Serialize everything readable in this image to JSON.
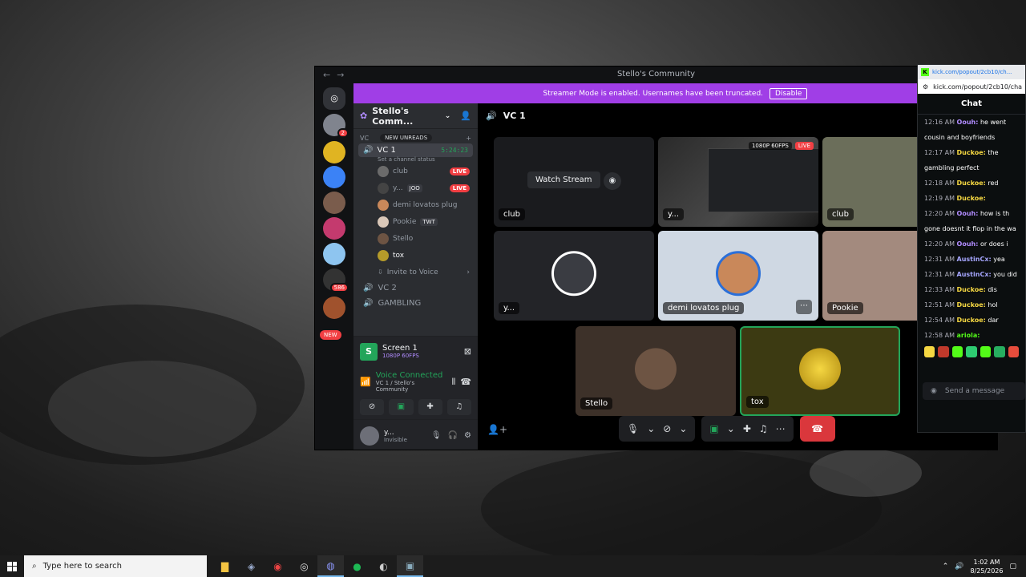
{
  "discord": {
    "window_title": "Stello's Community",
    "banner_text": "Streamer Mode is enabled. Usernames have been truncated.",
    "banner_button": "Disable",
    "server_name": "Stello's Comm...",
    "rail_badges": [
      "2",
      "586"
    ],
    "rail_new": "NEW",
    "category_vc": "VC",
    "new_unreads": "NEW UNREADS",
    "active_channel": "VC 1",
    "active_timer": "5:24:23",
    "channel_status": "Set a channel status",
    "voice_users": [
      {
        "name": "club",
        "live": "LIVE"
      },
      {
        "name": "y...",
        "tag": "JOO",
        "live": "LIVE"
      },
      {
        "name": "demi lovatos plug"
      },
      {
        "name": "Pookie",
        "tag": "TWT"
      },
      {
        "name": "Stello"
      },
      {
        "name": "tox"
      }
    ],
    "invite_label": "Invite to Voice",
    "channel_vc2": "VC 2",
    "channel_gambling": "GAMBLING",
    "screen_title": "Screen 1",
    "screen_quality": "1080P 60FPS",
    "voice_connected": "Voice Connected",
    "voice_sub": "VC 1 / Stello's Community",
    "user_name": "y...",
    "user_status": "Invisible",
    "call_header": "VC 1",
    "watch_stream": "Watch Stream",
    "stream_quality": "1080P 60FPS",
    "stream_live": "LIVE",
    "tiles": {
      "club1": "club",
      "y1": "y...",
      "club2": "club",
      "y2": "y...",
      "demi": "demi lovatos plug",
      "pookie": "Pookie",
      "stello": "Stello",
      "tox": "tox"
    }
  },
  "kick": {
    "tab_url": "kick.com/popout/2cb10/ch...",
    "address": "kick.com/popout/2cb10/cha",
    "header": "Chat",
    "messages": [
      {
        "time": "12:16 AM",
        "user": "Oouh:",
        "text": "he went",
        "color": "#b18cff"
      },
      {
        "time": "",
        "user": "",
        "text": "cousin and boyfriends",
        "color": "#fff"
      },
      {
        "time": "12:17 AM",
        "user": "Duckoe:",
        "text": "the",
        "color": "#f5d742"
      },
      {
        "time": "",
        "user": "",
        "text": "gambling perfect",
        "color": "#fff"
      },
      {
        "time": "12:18 AM",
        "user": "Duckoe:",
        "text": "red",
        "color": "#f5d742"
      },
      {
        "time": "12:19 AM",
        "user": "Duckoe:",
        "text": "",
        "color": "#f5d742"
      },
      {
        "time": "12:20 AM",
        "user": "Oouh:",
        "text": "how is th",
        "color": "#b18cff"
      },
      {
        "time": "",
        "user": "",
        "text": "gone doesnt it flop in the wa",
        "color": "#fff"
      },
      {
        "time": "12:20 AM",
        "user": "Oouh:",
        "text": "or does i",
        "color": "#b18cff"
      },
      {
        "time": "12:31 AM",
        "user": "AustinCx:",
        "text": "yea",
        "color": "#a6a6ff"
      },
      {
        "time": "12:31 AM",
        "user": "AustinCx:",
        "text": "you did",
        "color": "#a6a6ff"
      },
      {
        "time": "12:33 AM",
        "user": "Duckoe:",
        "text": "dis",
        "color": "#f5d742"
      },
      {
        "time": "12:51 AM",
        "user": "Duckoe:",
        "text": "hol",
        "color": "#f5d742"
      },
      {
        "time": "12:54 AM",
        "user": "Duckoe:",
        "text": "dar",
        "color": "#f5d742"
      },
      {
        "time": "12:58 AM",
        "user": "ariola:",
        "text": "",
        "color": "#53fc18"
      }
    ],
    "input_placeholder": "Send a message"
  },
  "taskbar": {
    "search_placeholder": "Type here to search",
    "time": "1:02 AM",
    "date": "8/25/2026"
  }
}
